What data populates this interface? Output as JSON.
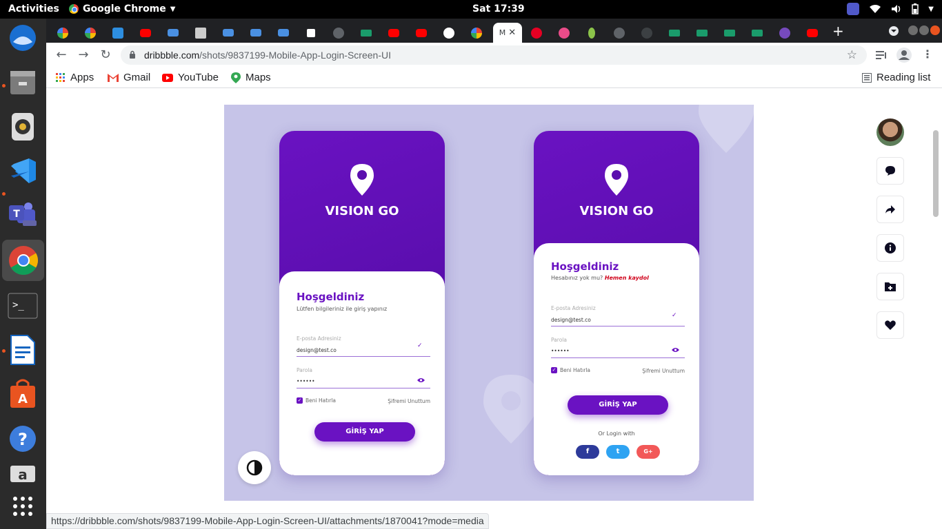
{
  "system": {
    "activities": "Activities",
    "app_menu": "Google Chrome",
    "clock": "Sat 17:39"
  },
  "browser": {
    "url_domain": "dribbble.com",
    "url_path": "/shots/9837199-Mobile-App-Login-Screen-UI",
    "reading_list": "Reading list",
    "bookmarks": [
      {
        "label": "Apps"
      },
      {
        "label": "Gmail"
      },
      {
        "label": "YouTube"
      },
      {
        "label": "Maps"
      }
    ],
    "status_url": "https://dribbble.com/shots/9837199-Mobile-App-Login-Screen-UI/attachments/1870041?mode=media"
  },
  "shot": {
    "left_phone": {
      "brand": "VISION GO",
      "title": "Hoşgeldiniz",
      "subtitle": "Lütfen bilgileriniz ile giriş yapınız",
      "email_label": "E-posta Adresiniz",
      "email_value": "design@test.co",
      "password_label": "Parola",
      "password_value": "••••••",
      "remember": "Beni Hatırla",
      "forgot": "Şifremi Unuttum",
      "login": "GİRİŞ YAP"
    },
    "right_phone": {
      "brand": "VISION GO",
      "title": "Hoşgeldiniz",
      "subtitle": "Hesabınız yok mu?",
      "signup": "Hemen kaydol",
      "email_label": "E-posta Adresiniz",
      "email_value": "design@test.co",
      "password_label": "Parola",
      "password_value": "••••••",
      "remember": "Beni Hatırla",
      "forgot": "Şifremi Unuttum",
      "login": "GİRİŞ YAP",
      "or_login": "Or Login with",
      "social": [
        "f",
        "t",
        "G+"
      ]
    }
  },
  "colors": {
    "brand_purple": "#6a12c2",
    "shot_background": "#c6c4e8",
    "signup_red": "#d0021b",
    "facebook": "#2d3a9a",
    "twitter": "#2ea3f2",
    "google": "#f25858"
  }
}
